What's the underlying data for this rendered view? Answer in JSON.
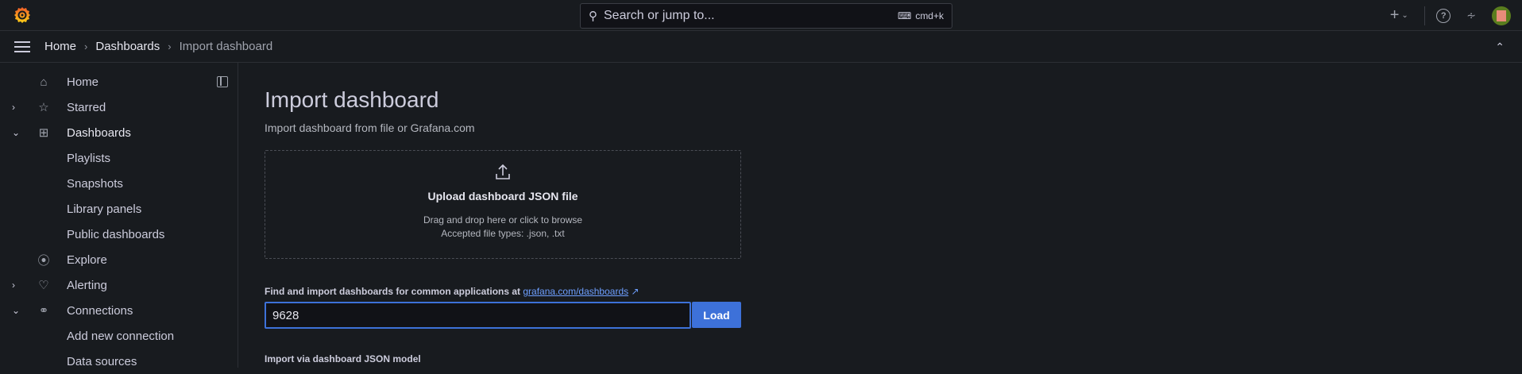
{
  "topbar": {
    "search_placeholder": "Search or jump to...",
    "shortcut": "cmd+k"
  },
  "breadcrumb": [
    "Home",
    "Dashboards",
    "Import dashboard"
  ],
  "sidebar": {
    "items": [
      {
        "label": "Home",
        "icon": "home-icon",
        "chevron": ""
      },
      {
        "label": "Starred",
        "icon": "star-icon",
        "chevron": "›"
      },
      {
        "label": "Dashboards",
        "icon": "apps-icon",
        "chevron": "⌄"
      },
      {
        "label": "Playlists",
        "icon": "",
        "chevron": ""
      },
      {
        "label": "Snapshots",
        "icon": "",
        "chevron": ""
      },
      {
        "label": "Library panels",
        "icon": "",
        "chevron": ""
      },
      {
        "label": "Public dashboards",
        "icon": "",
        "chevron": ""
      },
      {
        "label": "Explore",
        "icon": "compass-icon",
        "chevron": ""
      },
      {
        "label": "Alerting",
        "icon": "bell-icon",
        "chevron": "›"
      },
      {
        "label": "Connections",
        "icon": "link-icon",
        "chevron": "⌄"
      },
      {
        "label": "Add new connection",
        "icon": "",
        "chevron": ""
      },
      {
        "label": "Data sources",
        "icon": "",
        "chevron": ""
      }
    ]
  },
  "main": {
    "title": "Import dashboard",
    "subtitle": "Import dashboard from file or Grafana.com",
    "upload_title": "Upload dashboard JSON file",
    "upload_hint": "Drag and drop here or click to browse",
    "upload_types": "Accepted file types: .json, .txt",
    "find_label": "Find and import dashboards for common applications at",
    "find_link": "grafana.com/dashboards",
    "input_value": "9628",
    "load_label": "Load",
    "json_label": "Import via dashboard JSON model"
  }
}
